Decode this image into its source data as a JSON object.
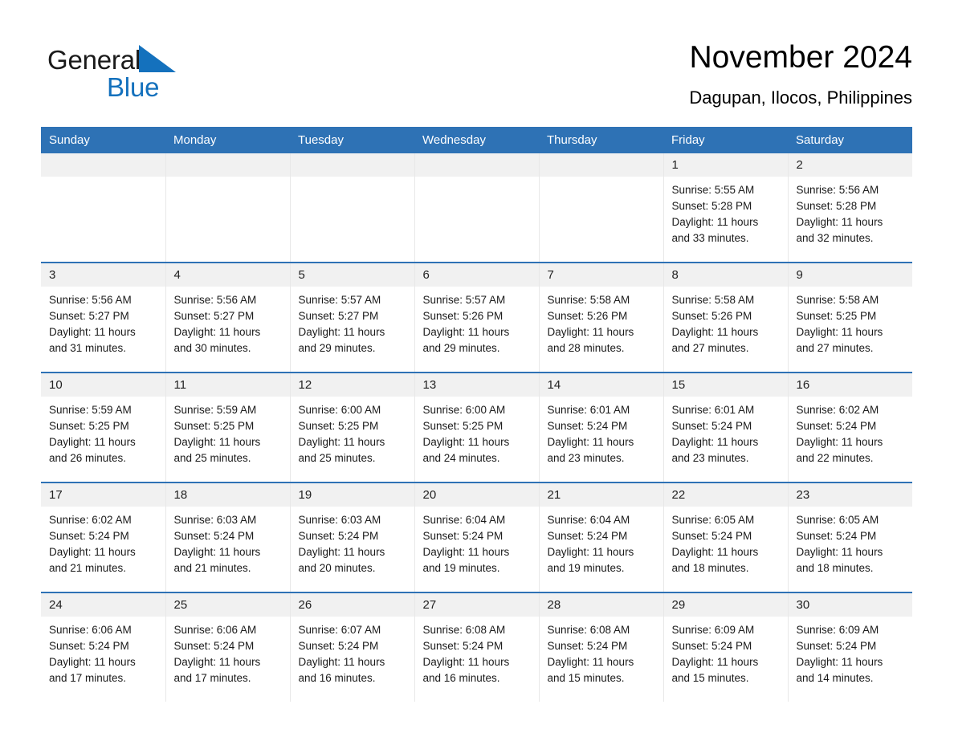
{
  "brand": {
    "name_part1": "General",
    "name_part2": "Blue",
    "triangle_color": "#1471bd"
  },
  "header": {
    "title": "November 2024",
    "subtitle": "Dagupan, Ilocos, Philippines",
    "accent_color": "#2e72b5",
    "daynum_band_color": "#f1f1f1"
  },
  "weekday_headers": [
    "Sunday",
    "Monday",
    "Tuesday",
    "Wednesday",
    "Thursday",
    "Friday",
    "Saturday"
  ],
  "weeks": [
    [
      {
        "day": "",
        "sunrise": "",
        "sunset": "",
        "daylight1": "",
        "daylight2": ""
      },
      {
        "day": "",
        "sunrise": "",
        "sunset": "",
        "daylight1": "",
        "daylight2": ""
      },
      {
        "day": "",
        "sunrise": "",
        "sunset": "",
        "daylight1": "",
        "daylight2": ""
      },
      {
        "day": "",
        "sunrise": "",
        "sunset": "",
        "daylight1": "",
        "daylight2": ""
      },
      {
        "day": "",
        "sunrise": "",
        "sunset": "",
        "daylight1": "",
        "daylight2": ""
      },
      {
        "day": "1",
        "sunrise": "Sunrise: 5:55 AM",
        "sunset": "Sunset: 5:28 PM",
        "daylight1": "Daylight: 11 hours",
        "daylight2": "and 33 minutes."
      },
      {
        "day": "2",
        "sunrise": "Sunrise: 5:56 AM",
        "sunset": "Sunset: 5:28 PM",
        "daylight1": "Daylight: 11 hours",
        "daylight2": "and 32 minutes."
      }
    ],
    [
      {
        "day": "3",
        "sunrise": "Sunrise: 5:56 AM",
        "sunset": "Sunset: 5:27 PM",
        "daylight1": "Daylight: 11 hours",
        "daylight2": "and 31 minutes."
      },
      {
        "day": "4",
        "sunrise": "Sunrise: 5:56 AM",
        "sunset": "Sunset: 5:27 PM",
        "daylight1": "Daylight: 11 hours",
        "daylight2": "and 30 minutes."
      },
      {
        "day": "5",
        "sunrise": "Sunrise: 5:57 AM",
        "sunset": "Sunset: 5:27 PM",
        "daylight1": "Daylight: 11 hours",
        "daylight2": "and 29 minutes."
      },
      {
        "day": "6",
        "sunrise": "Sunrise: 5:57 AM",
        "sunset": "Sunset: 5:26 PM",
        "daylight1": "Daylight: 11 hours",
        "daylight2": "and 29 minutes."
      },
      {
        "day": "7",
        "sunrise": "Sunrise: 5:58 AM",
        "sunset": "Sunset: 5:26 PM",
        "daylight1": "Daylight: 11 hours",
        "daylight2": "and 28 minutes."
      },
      {
        "day": "8",
        "sunrise": "Sunrise: 5:58 AM",
        "sunset": "Sunset: 5:26 PM",
        "daylight1": "Daylight: 11 hours",
        "daylight2": "and 27 minutes."
      },
      {
        "day": "9",
        "sunrise": "Sunrise: 5:58 AM",
        "sunset": "Sunset: 5:25 PM",
        "daylight1": "Daylight: 11 hours",
        "daylight2": "and 27 minutes."
      }
    ],
    [
      {
        "day": "10",
        "sunrise": "Sunrise: 5:59 AM",
        "sunset": "Sunset: 5:25 PM",
        "daylight1": "Daylight: 11 hours",
        "daylight2": "and 26 minutes."
      },
      {
        "day": "11",
        "sunrise": "Sunrise: 5:59 AM",
        "sunset": "Sunset: 5:25 PM",
        "daylight1": "Daylight: 11 hours",
        "daylight2": "and 25 minutes."
      },
      {
        "day": "12",
        "sunrise": "Sunrise: 6:00 AM",
        "sunset": "Sunset: 5:25 PM",
        "daylight1": "Daylight: 11 hours",
        "daylight2": "and 25 minutes."
      },
      {
        "day": "13",
        "sunrise": "Sunrise: 6:00 AM",
        "sunset": "Sunset: 5:25 PM",
        "daylight1": "Daylight: 11 hours",
        "daylight2": "and 24 minutes."
      },
      {
        "day": "14",
        "sunrise": "Sunrise: 6:01 AM",
        "sunset": "Sunset: 5:24 PM",
        "daylight1": "Daylight: 11 hours",
        "daylight2": "and 23 minutes."
      },
      {
        "day": "15",
        "sunrise": "Sunrise: 6:01 AM",
        "sunset": "Sunset: 5:24 PM",
        "daylight1": "Daylight: 11 hours",
        "daylight2": "and 23 minutes."
      },
      {
        "day": "16",
        "sunrise": "Sunrise: 6:02 AM",
        "sunset": "Sunset: 5:24 PM",
        "daylight1": "Daylight: 11 hours",
        "daylight2": "and 22 minutes."
      }
    ],
    [
      {
        "day": "17",
        "sunrise": "Sunrise: 6:02 AM",
        "sunset": "Sunset: 5:24 PM",
        "daylight1": "Daylight: 11 hours",
        "daylight2": "and 21 minutes."
      },
      {
        "day": "18",
        "sunrise": "Sunrise: 6:03 AM",
        "sunset": "Sunset: 5:24 PM",
        "daylight1": "Daylight: 11 hours",
        "daylight2": "and 21 minutes."
      },
      {
        "day": "19",
        "sunrise": "Sunrise: 6:03 AM",
        "sunset": "Sunset: 5:24 PM",
        "daylight1": "Daylight: 11 hours",
        "daylight2": "and 20 minutes."
      },
      {
        "day": "20",
        "sunrise": "Sunrise: 6:04 AM",
        "sunset": "Sunset: 5:24 PM",
        "daylight1": "Daylight: 11 hours",
        "daylight2": "and 19 minutes."
      },
      {
        "day": "21",
        "sunrise": "Sunrise: 6:04 AM",
        "sunset": "Sunset: 5:24 PM",
        "daylight1": "Daylight: 11 hours",
        "daylight2": "and 19 minutes."
      },
      {
        "day": "22",
        "sunrise": "Sunrise: 6:05 AM",
        "sunset": "Sunset: 5:24 PM",
        "daylight1": "Daylight: 11 hours",
        "daylight2": "and 18 minutes."
      },
      {
        "day": "23",
        "sunrise": "Sunrise: 6:05 AM",
        "sunset": "Sunset: 5:24 PM",
        "daylight1": "Daylight: 11 hours",
        "daylight2": "and 18 minutes."
      }
    ],
    [
      {
        "day": "24",
        "sunrise": "Sunrise: 6:06 AM",
        "sunset": "Sunset: 5:24 PM",
        "daylight1": "Daylight: 11 hours",
        "daylight2": "and 17 minutes."
      },
      {
        "day": "25",
        "sunrise": "Sunrise: 6:06 AM",
        "sunset": "Sunset: 5:24 PM",
        "daylight1": "Daylight: 11 hours",
        "daylight2": "and 17 minutes."
      },
      {
        "day": "26",
        "sunrise": "Sunrise: 6:07 AM",
        "sunset": "Sunset: 5:24 PM",
        "daylight1": "Daylight: 11 hours",
        "daylight2": "and 16 minutes."
      },
      {
        "day": "27",
        "sunrise": "Sunrise: 6:08 AM",
        "sunset": "Sunset: 5:24 PM",
        "daylight1": "Daylight: 11 hours",
        "daylight2": "and 16 minutes."
      },
      {
        "day": "28",
        "sunrise": "Sunrise: 6:08 AM",
        "sunset": "Sunset: 5:24 PM",
        "daylight1": "Daylight: 11 hours",
        "daylight2": "and 15 minutes."
      },
      {
        "day": "29",
        "sunrise": "Sunrise: 6:09 AM",
        "sunset": "Sunset: 5:24 PM",
        "daylight1": "Daylight: 11 hours",
        "daylight2": "and 15 minutes."
      },
      {
        "day": "30",
        "sunrise": "Sunrise: 6:09 AM",
        "sunset": "Sunset: 5:24 PM",
        "daylight1": "Daylight: 11 hours",
        "daylight2": "and 14 minutes."
      }
    ]
  ]
}
